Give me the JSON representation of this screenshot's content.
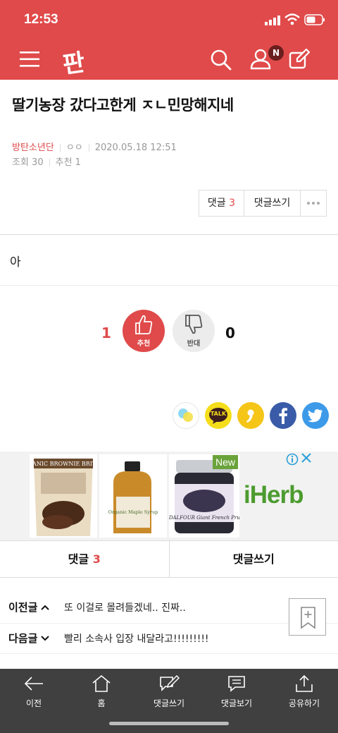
{
  "status_bar": {
    "time": "12:53"
  },
  "header": {
    "logo_text": "판",
    "notification_badge": "N",
    "accent_color": "#e04a4a"
  },
  "post": {
    "title": "딸기농장 갔다고한게 ㅈㄴ민망해지네",
    "author": "방탄소년단",
    "author_sub": "ㅇㅇ",
    "datetime": "2020.05.18 12:51",
    "views": "조회 30",
    "recommend": "추천 1",
    "body": "아"
  },
  "actions": {
    "comments_label": "댓글",
    "comments_count": "3",
    "write_comment": "댓글쓰기"
  },
  "vote": {
    "up_count": "1",
    "up_label": "추천",
    "down_label": "반대",
    "down_count": "0"
  },
  "share": {
    "icons": [
      "band-icon",
      "kakaotalk-icon",
      "kakaostory-icon",
      "facebook-icon",
      "twitter-icon"
    ],
    "talk_label": "TALK"
  },
  "ad": {
    "brand": "iHerb",
    "new_badge": "New",
    "products": [
      "ORGANIC BROWNIE BRITTLE",
      "Organic Maple Syrup",
      "ST. DALFOUR Giant French Prunes"
    ]
  },
  "tabs": {
    "comments_label": "댓글",
    "comments_count": "3",
    "write_label": "댓글쓰기"
  },
  "post_nav": {
    "prev_label": "이전글",
    "prev_title": "또 이걸로 몰려들겠네.. 진짜..",
    "next_label": "다음글",
    "next_title": "빨리 소속사 입장 내달라고!!!!!!!!!"
  },
  "bottom_nav": [
    {
      "label": "이전",
      "icon": "back-arrow-icon"
    },
    {
      "label": "홈",
      "icon": "home-icon"
    },
    {
      "label": "댓글쓰기",
      "icon": "write-comment-icon"
    },
    {
      "label": "댓글보기",
      "icon": "view-comments-icon"
    },
    {
      "label": "공유하기",
      "icon": "share-icon"
    }
  ]
}
